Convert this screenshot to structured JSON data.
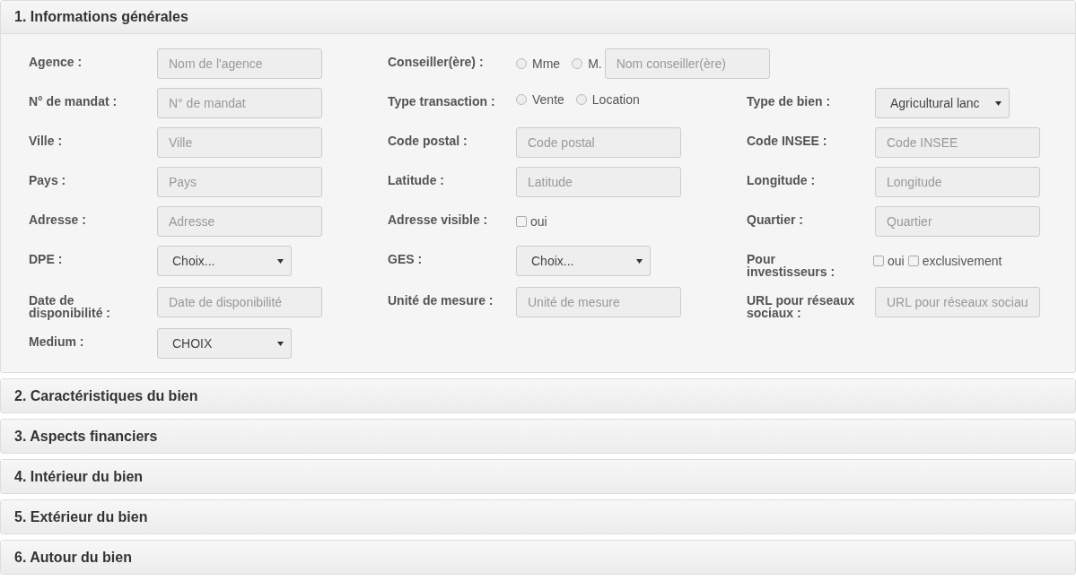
{
  "sections": [
    {
      "title": "1. Informations générales",
      "expanded": true,
      "rows": [
        {
          "fields": [
            {
              "kind": "text",
              "label": "Agence :",
              "placeholder": "Nom de l'agence"
            },
            {
              "kind": "radios_text",
              "label": "Conseiller(ère) :",
              "options": [
                {
                  "label": "Mme",
                  "selected": false
                },
                {
                  "label": "M.",
                  "selected": false
                }
              ],
              "placeholder": "Nom conseiller(ère)"
            }
          ]
        },
        {
          "fields": [
            {
              "kind": "text",
              "label": "N° de mandat :",
              "placeholder": "N° de mandat"
            },
            {
              "kind": "radios",
              "label": "Type transaction :",
              "options": [
                {
                  "label": "Vente",
                  "selected": false
                },
                {
                  "label": "Location",
                  "selected": false
                }
              ]
            },
            {
              "kind": "select",
              "label": "Type de bien :",
              "value": "Agricultural lanc"
            }
          ]
        },
        {
          "fields": [
            {
              "kind": "text",
              "label": "Ville :",
              "placeholder": "Ville"
            },
            {
              "kind": "text",
              "label": "Code postal :",
              "placeholder": "Code postal"
            },
            {
              "kind": "text",
              "label": "Code INSEE :",
              "placeholder": "Code INSEE"
            }
          ]
        },
        {
          "fields": [
            {
              "kind": "text",
              "label": "Pays :",
              "placeholder": "Pays"
            },
            {
              "kind": "text",
              "label": "Latitude :",
              "placeholder": "Latitude"
            },
            {
              "kind": "text",
              "label": "Longitude :",
              "placeholder": "Longitude"
            }
          ]
        },
        {
          "fields": [
            {
              "kind": "text",
              "label": "Adresse :",
              "placeholder": "Adresse"
            },
            {
              "kind": "checks",
              "label": "Adresse visible :",
              "options": [
                {
                  "label": "oui",
                  "checked": false
                }
              ]
            },
            {
              "kind": "text",
              "label": "Quartier :",
              "placeholder": "Quartier"
            }
          ]
        },
        {
          "fields": [
            {
              "kind": "select",
              "label": "DPE :",
              "value": "Choix..."
            },
            {
              "kind": "select",
              "label": "GES :",
              "value": "Choix..."
            },
            {
              "kind": "checks",
              "label": "Pour investisseurs :",
              "options": [
                {
                  "label": "oui",
                  "checked": false
                },
                {
                  "label": "exclusivement",
                  "checked": false
                }
              ]
            }
          ]
        },
        {
          "fields": [
            {
              "kind": "text",
              "label": "Date de disponibilité :",
              "placeholder": "Date de disponibilité"
            },
            {
              "kind": "text",
              "label": "Unité de mesure :",
              "placeholder": "Unité de mesure"
            },
            {
              "kind": "text",
              "label": "URL pour réseaux sociaux :",
              "placeholder": "URL pour réseaux sociau"
            }
          ]
        },
        {
          "fields": [
            {
              "kind": "select",
              "label": "Medium :",
              "value": "CHOIX"
            }
          ]
        }
      ]
    },
    {
      "title": "2. Caractéristiques du bien",
      "expanded": false
    },
    {
      "title": "3. Aspects financiers",
      "expanded": false
    },
    {
      "title": "4. Intérieur du bien",
      "expanded": false
    },
    {
      "title": "5. Extérieur du bien",
      "expanded": false
    },
    {
      "title": "6. Autour du bien",
      "expanded": false
    }
  ]
}
